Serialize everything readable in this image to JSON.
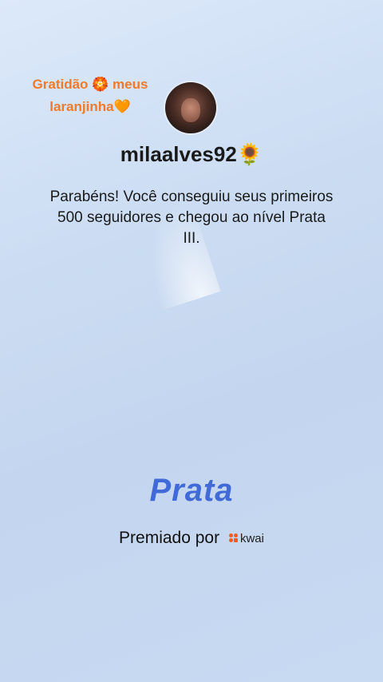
{
  "caption": "Gratidão 🏵️ meus laranjinha🧡",
  "profile": {
    "username": "milaalves92🌻",
    "avatar_icon": "profile-photo"
  },
  "message": "Parabéns! Você conseguiu seus primeiros 500 seguidores e chegou ao nível Prata III.",
  "level": "Prata",
  "awarded": {
    "label": "Premiado por",
    "brand": "kwai",
    "brand_icon": "kwai-logo-icon",
    "brand_color": "#ff5a1f"
  },
  "colors": {
    "caption": "#f07a2a",
    "level": "#3f6ad8"
  }
}
